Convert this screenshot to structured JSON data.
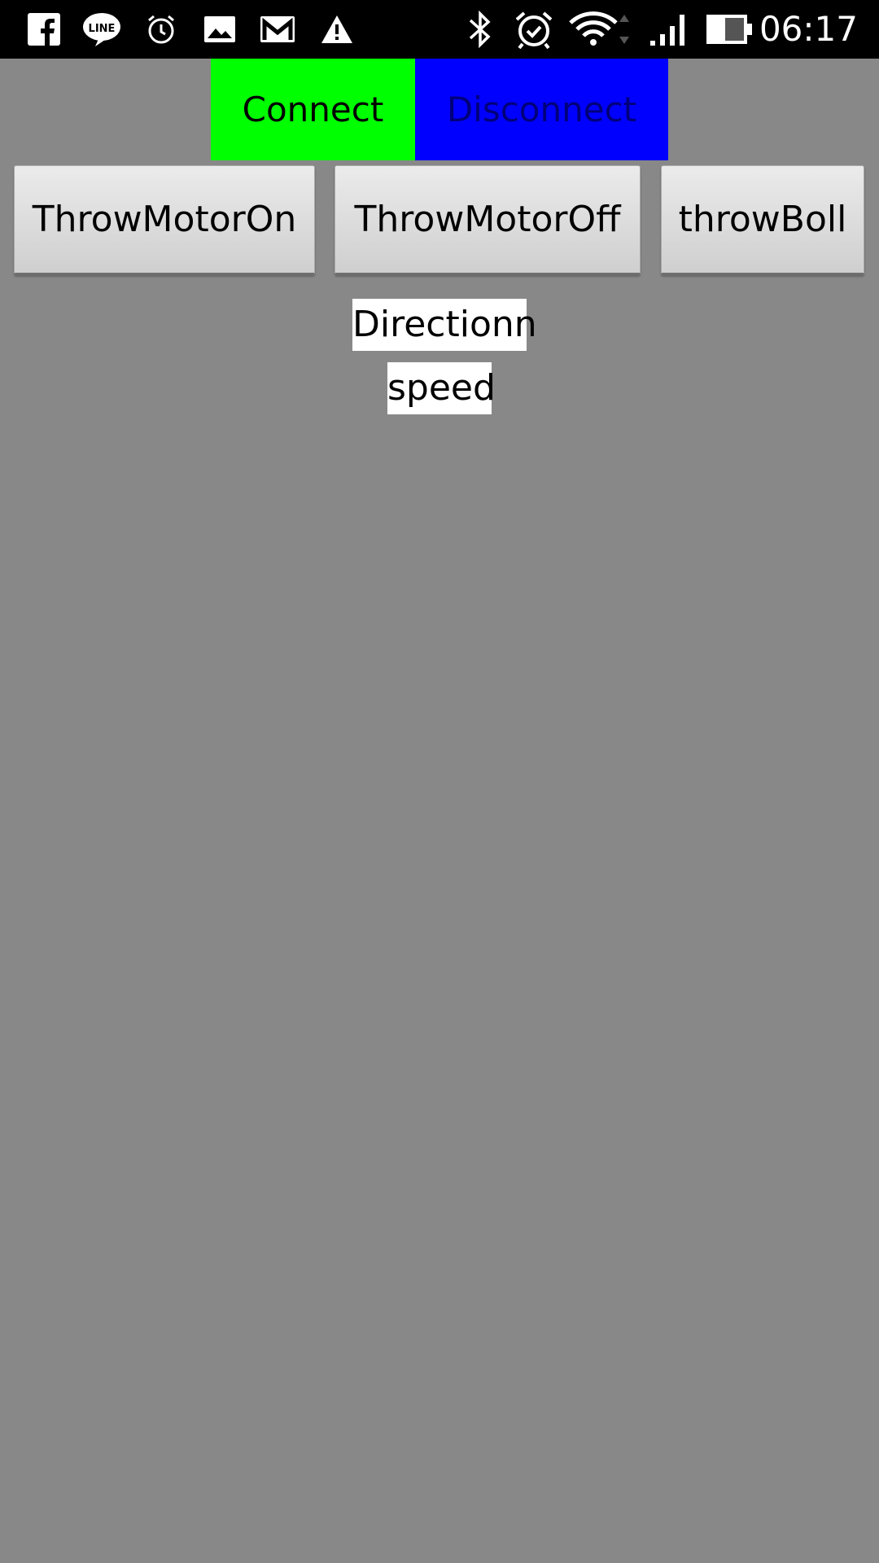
{
  "status_bar": {
    "time": "06:17",
    "left_icons": [
      "facebook-icon",
      "line-icon",
      "alarm-icon",
      "gallery-icon",
      "gmail-icon",
      "warning-icon"
    ],
    "right_icons": [
      "bluetooth-icon",
      "alarm-clock-icon",
      "wifi-icon",
      "signal-icon",
      "battery-icon"
    ]
  },
  "connection": {
    "connect_label": "Connect",
    "disconnect_label": "Disconnect",
    "connect_color": "#00ff00",
    "disconnect_color": "#0000ff"
  },
  "motor_controls": {
    "throw_motor_on_label": "ThrowMotorOn",
    "throw_motor_off_label": "ThrowMotorOff",
    "throw_boll_label": "throwBoll"
  },
  "readouts": {
    "direction_label": "Directionn",
    "speed_label": "speed"
  },
  "colors": {
    "background": "#888888",
    "status_bar": "#000000"
  }
}
